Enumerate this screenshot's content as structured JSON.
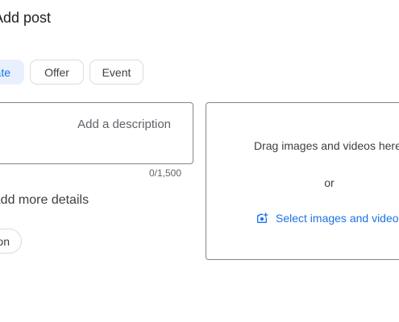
{
  "header": {
    "title": "Add post"
  },
  "post_types": [
    {
      "label": "Add update",
      "selected": true
    },
    {
      "label": "Offer",
      "selected": false
    },
    {
      "label": "Event",
      "selected": false
    }
  ],
  "description": {
    "placeholder": "Add a description",
    "counter": "0/1,500"
  },
  "button_section": {
    "heading": "Add more details",
    "button_label": "Add button"
  },
  "media": {
    "drag_text": "Drag images and videos here",
    "or_text": "or",
    "select_label": "Select images and videos",
    "select_icon": "add-photo-icon"
  },
  "colors": {
    "accent": "#1a73e8",
    "chip_selected_bg": "#e8f0fe",
    "border": "#dadce0",
    "field_border": "#80868b"
  }
}
